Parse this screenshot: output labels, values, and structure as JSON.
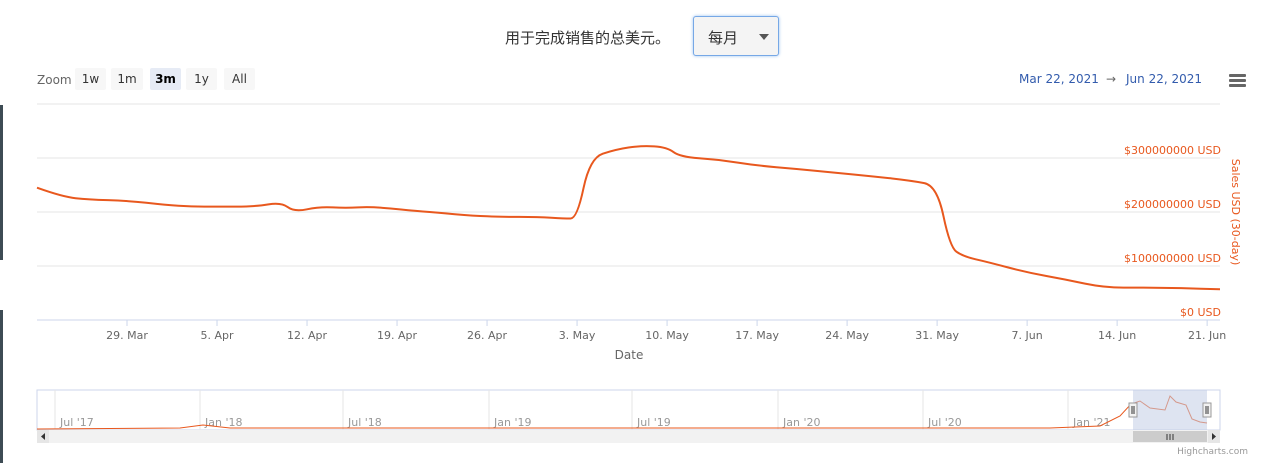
{
  "header": {
    "title": "用于完成销售的总美元。",
    "period_select_value": "每月"
  },
  "range_selector": {
    "zoom_label": "Zoom",
    "buttons": [
      "1w",
      "1m",
      "3m",
      "1y",
      "All"
    ],
    "active": "3m",
    "from_date": "Mar 22, 2021",
    "arrow": "→",
    "to_date": "Jun 22, 2021"
  },
  "colors": {
    "series": "#e8581e",
    "nav_mask": "#c3cde5"
  },
  "icons": {
    "menu": "hamburger-menu-icon"
  },
  "chart_data": {
    "type": "line",
    "xlabel": "Date",
    "ylabel": "Sales USD (30-day)",
    "x_tick_labels": [
      "29. Mar",
      "5. Apr",
      "12. Apr",
      "19. Apr",
      "26. Apr",
      "3. May",
      "10. May",
      "17. May",
      "24. May",
      "31. May",
      "7. Jun",
      "14. Jun",
      "21. Jun"
    ],
    "y_tick_labels": [
      "$0 USD",
      "$100000000 USD",
      "$200000000 USD",
      "$300000000 USD"
    ],
    "ylim": [
      0,
      400000000
    ],
    "xlim": [
      "2021-03-22",
      "2021-06-22"
    ],
    "grid": true,
    "series": [
      {
        "x": [
          "2021-03-22",
          "2021-03-24",
          "2021-03-26",
          "2021-03-29",
          "2021-04-01",
          "2021-04-03",
          "2021-04-05",
          "2021-04-08",
          "2021-04-10",
          "2021-04-11",
          "2021-04-13",
          "2021-04-15",
          "2021-04-17",
          "2021-04-20",
          "2021-04-22",
          "2021-04-25",
          "2021-04-27",
          "2021-04-30",
          "2021-05-02",
          "2021-05-03",
          "2021-05-04",
          "2021-05-06",
          "2021-05-08",
          "2021-05-10",
          "2021-05-11",
          "2021-05-14",
          "2021-05-17",
          "2021-05-20",
          "2021-05-23",
          "2021-05-26",
          "2021-05-29",
          "2021-05-31",
          "2021-06-01",
          "2021-06-02",
          "2021-06-04",
          "2021-06-07",
          "2021-06-10",
          "2021-06-13",
          "2021-06-16",
          "2021-06-19",
          "2021-06-22"
        ],
        "y": [
          245000000,
          228000000,
          223000000,
          221000000,
          213000000,
          210000000,
          210000000,
          210000000,
          218000000,
          200000000,
          210000000,
          207000000,
          210000000,
          203000000,
          199000000,
          193000000,
          191000000,
          191000000,
          188000000,
          188000000,
          300000000,
          316000000,
          323000000,
          320000000,
          302000000,
          297000000,
          286000000,
          280000000,
          273000000,
          266000000,
          258000000,
          249000000,
          135000000,
          118000000,
          107000000,
          88000000,
          75000000,
          60000000,
          60000000,
          59000000,
          57000000
        ]
      }
    ],
    "navigator": {
      "x_tick_labels": [
        "Jul '17",
        "Jan '18",
        "Jul '18",
        "Jan '19",
        "Jul '19",
        "Jan '20",
        "Jul '20",
        "Jan '21"
      ]
    },
    "credits": "Highcharts.com"
  }
}
